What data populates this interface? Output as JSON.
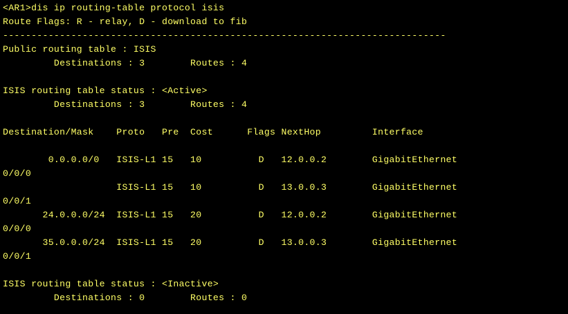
{
  "terminal": {
    "foreground": "#ffff66",
    "background": "#000000",
    "lines": [
      "<AR1>dis ip routing-table protocol isis",
      "Route Flags: R - relay, D - download to fib",
      "------------------------------------------------------------------------------",
      "Public routing table : ISIS",
      "         Destinations : 3        Routes : 4",
      "",
      "ISIS routing table status : <Active>",
      "         Destinations : 3        Routes : 4",
      "",
      "Destination/Mask    Proto   Pre  Cost      Flags NextHop         Interface",
      "",
      "        0.0.0.0/0   ISIS-L1 15   10          D   12.0.0.2        GigabitEthernet",
      "0/0/0",
      "                    ISIS-L1 15   10          D   13.0.0.3        GigabitEthernet",
      "0/0/1",
      "       24.0.0.0/24  ISIS-L1 15   20          D   12.0.0.2        GigabitEthernet",
      "0/0/0",
      "       35.0.0.0/24  ISIS-L1 15   20          D   13.0.0.3        GigabitEthernet",
      "0/0/1",
      "",
      "ISIS routing table status : <Inactive>",
      "         Destinations : 0        Routes : 0"
    ]
  }
}
